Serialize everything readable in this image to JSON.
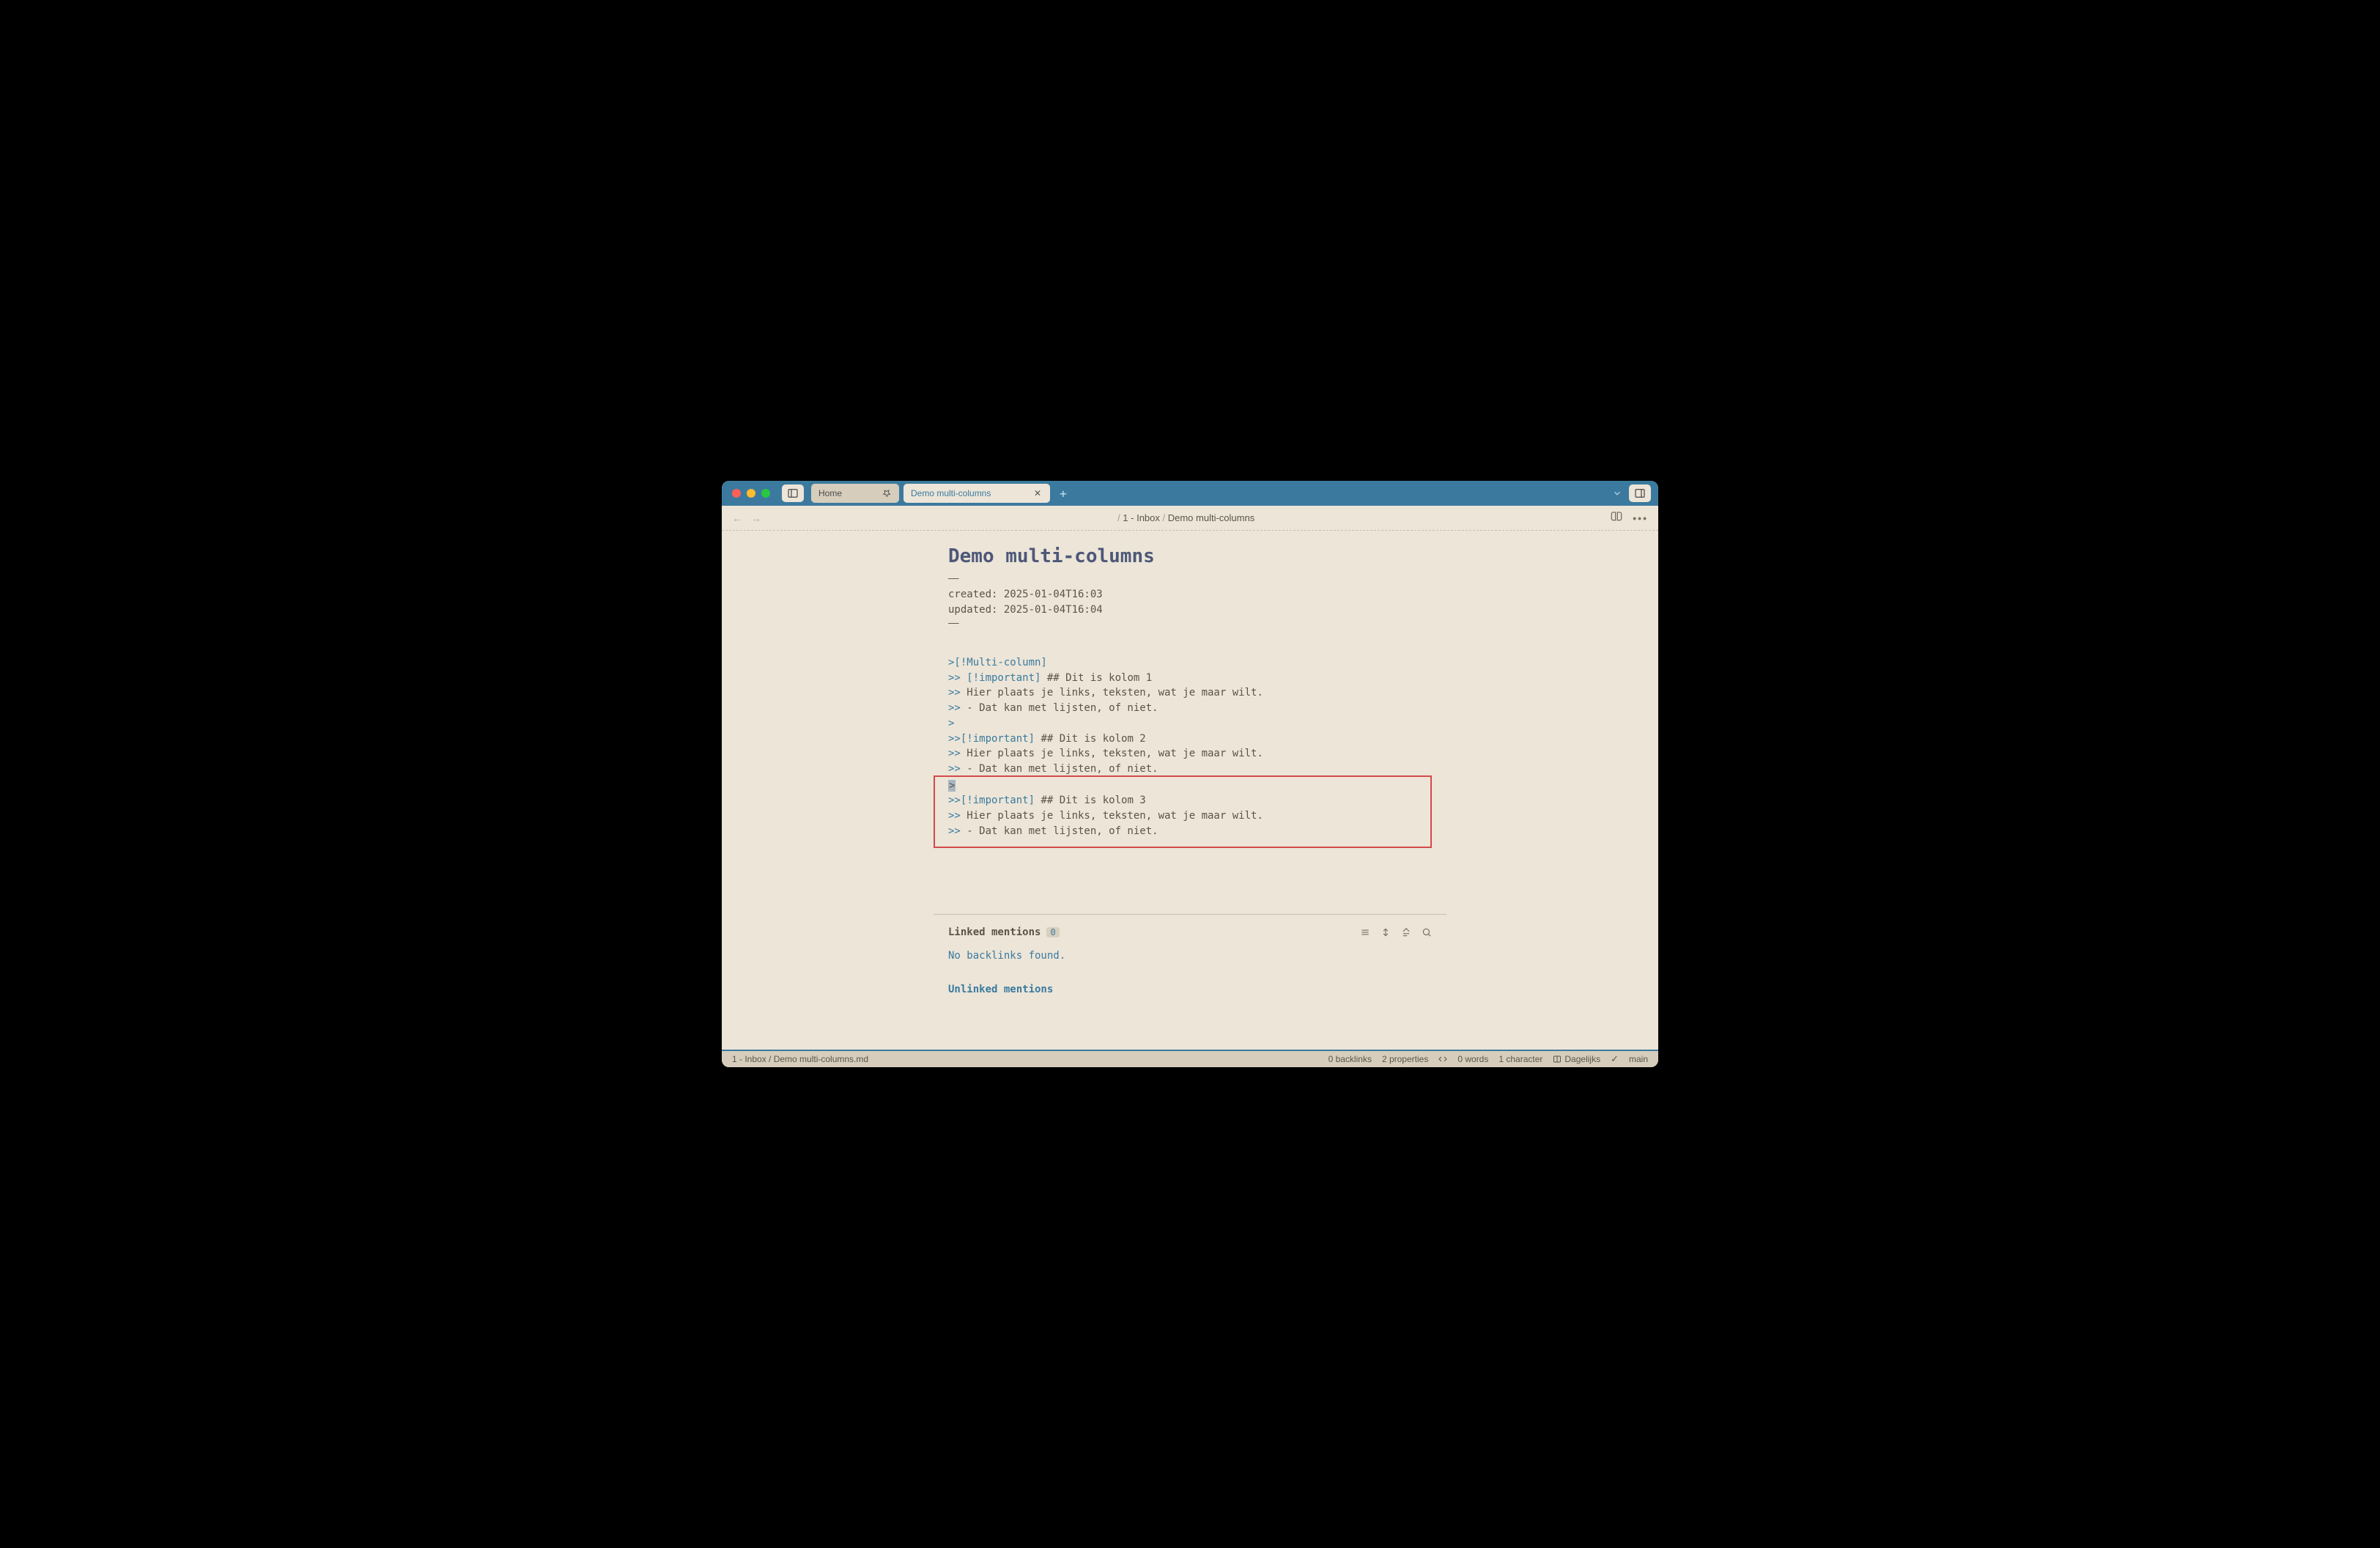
{
  "tabs": {
    "home": "Home",
    "active": "Demo multi-columns"
  },
  "breadcrumb": {
    "seg1": "1 - Inbox",
    "seg2": "Demo multi-columns"
  },
  "note": {
    "title": "Demo multi-columns",
    "created_label": "created: ",
    "created_value": "2025-01-04T16:03",
    "updated_label": "updated: ",
    "updated_value": "2025-01-04T16:04",
    "hr": "——"
  },
  "src": {
    "l1_blue": ">[!Multi-column]",
    "l2_blue": ">> [!important]",
    "l2_gray": " ## Dit is kolom 1",
    "l3_blue": ">>",
    "l3_gray": " Hier plaats je links, teksten, wat je maar wilt.",
    "l4_blue": ">>",
    "l4_gray": " - Dat kan met lijsten, of niet.",
    "l5_blue": ">",
    "l6_blue": ">>[!important]",
    "l6_gray": " ## Dit is kolom 2",
    "l7_blue": ">>",
    "l7_gray": " Hier plaats je links, teksten, wat je maar wilt.",
    "l8_blue": ">>",
    "l8_gray": " - Dat kan met lijsten, of niet.",
    "l9_sel": ">",
    "l10_blue": ">>[!important]",
    "l10_gray": " ## Dit is kolom 3",
    "l11_blue": ">>",
    "l11_gray": " Hier plaats je links, teksten, wat je maar wilt.",
    "l12_blue": ">>",
    "l12_gray": " - Dat kan met lijsten, of niet."
  },
  "backlinks": {
    "linked_title": "Linked mentions",
    "linked_count": "0",
    "none": "No backlinks found.",
    "unlinked_title": "Unlinked mentions"
  },
  "status": {
    "path": "1 - Inbox / Demo multi-columns.md",
    "backlinks": "0 backlinks",
    "properties": "2 properties",
    "words": "0 words",
    "chars": "1 character",
    "layout": "Dagelijks",
    "branch": "main"
  }
}
